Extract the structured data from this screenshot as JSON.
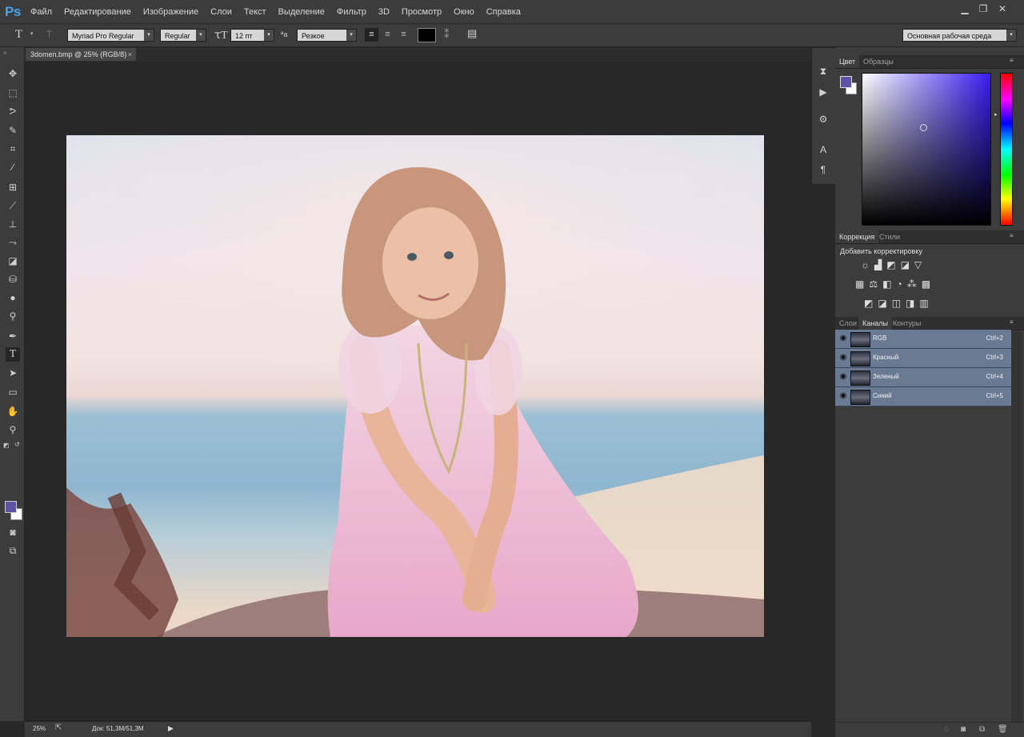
{
  "app": {
    "logo": "Ps"
  },
  "menu": [
    "Файл",
    "Редактирование",
    "Изображение",
    "Слои",
    "Текст",
    "Выделение",
    "Фильтр",
    "3D",
    "Просмотр",
    "Окно",
    "Справка"
  ],
  "options": {
    "font_family": "Myriad Pro Regular",
    "font_style": "Regular",
    "font_size": "12 пт",
    "aa_label": "ªa",
    "antialias": "Резкое",
    "color": "#000000",
    "workspace": "Основная рабочая среда"
  },
  "document": {
    "tab_title": "3domen.bmp @ 25% (RGB/8)",
    "close": "×"
  },
  "color_panel": {
    "tabs": [
      "Цвет",
      "Образцы"
    ],
    "foreground": "#5c53a6",
    "background": "#ffffff",
    "hue": "#3a1cf0"
  },
  "adjust_panel": {
    "tabs": [
      "Коррекция",
      "Стили"
    ],
    "heading": "Добавить корректировку"
  },
  "layers_panel": {
    "tabs": [
      "Слои",
      "Каналы",
      "Контуры"
    ],
    "channels": [
      {
        "name": "RGB",
        "shortcut": "Ctrl+2"
      },
      {
        "name": "Красный",
        "shortcut": "Ctrl+3"
      },
      {
        "name": "Зеленый",
        "shortcut": "Ctrl+4"
      },
      {
        "name": "Синий",
        "shortcut": "Ctrl+5"
      }
    ]
  },
  "status": {
    "zoom": "25%",
    "doc_size": "Док: 51,3M/51,3M"
  },
  "toolbox": {
    "fg": "#5c53a6",
    "bg": "#ffffff"
  }
}
